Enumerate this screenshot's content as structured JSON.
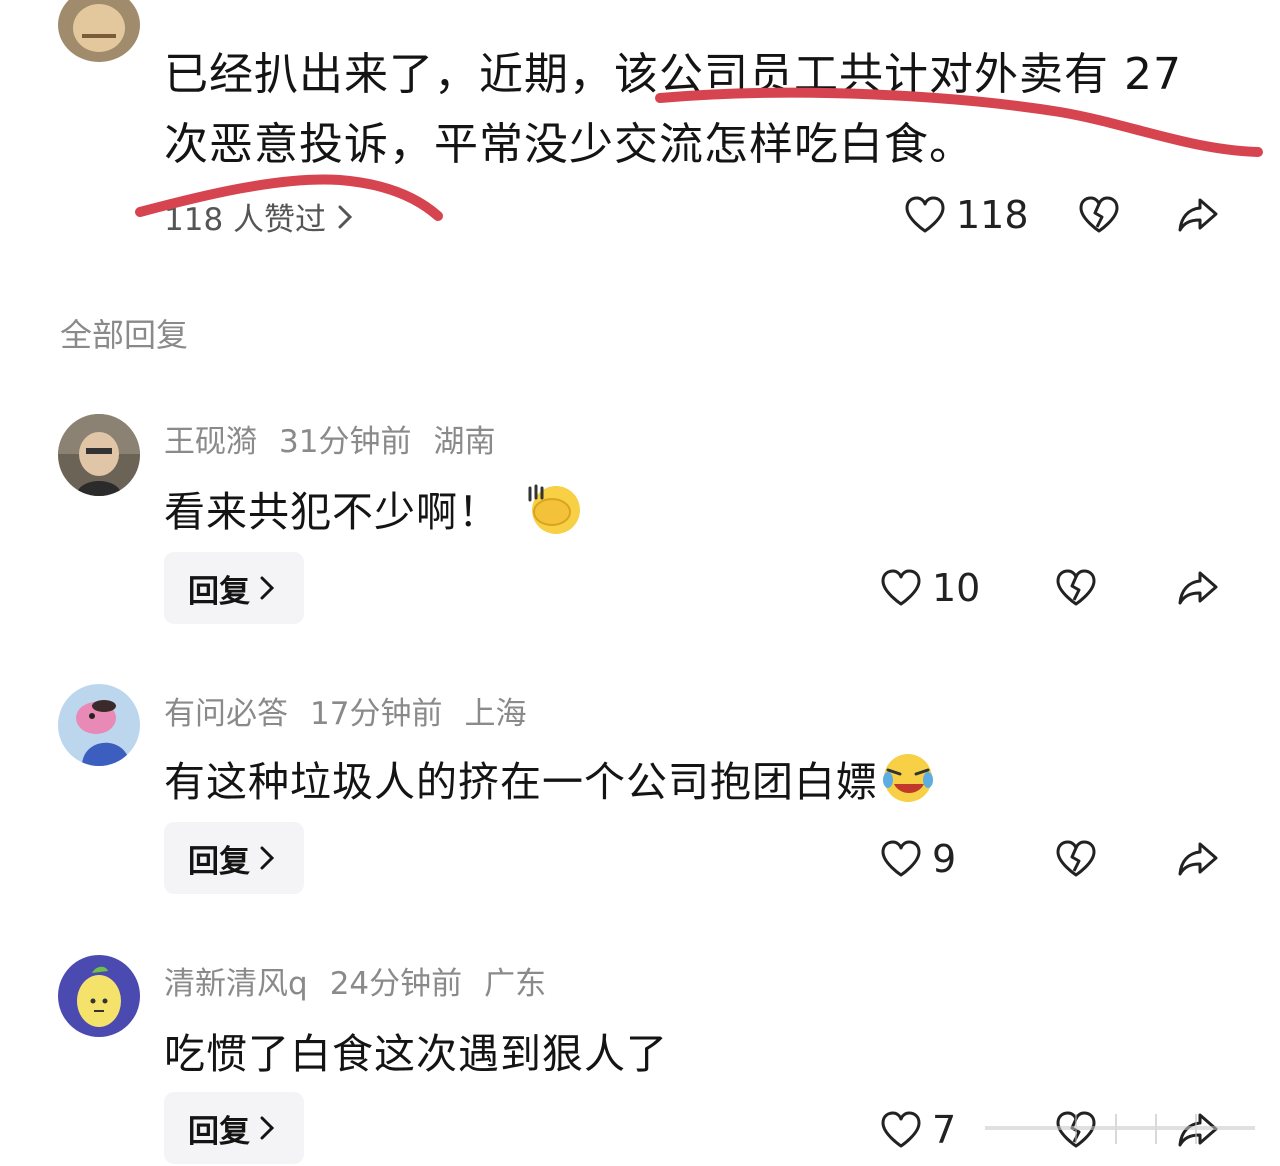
{
  "main_comment": {
    "text_line1": "已经扒出来了，近期，该公司员工共计对外卖有 27",
    "text_line2": "次恶意投诉，平常没少交流怎样吃白食。",
    "likes_summary": "118 人赞过",
    "like_count": "118"
  },
  "section": {
    "title": "全部回复"
  },
  "replies": [
    {
      "username": "王砚漪",
      "time": "31分钟前",
      "location": "湖南",
      "content": "看来共犯不少啊！",
      "emoji": "facepalm",
      "reply_label": "回复",
      "like_count": "10"
    },
    {
      "username": "有问必答",
      "time": "17分钟前",
      "location": "上海",
      "content": "有这种垃圾人的挤在一个公司抱团白嫖",
      "emoji": "rofl",
      "reply_label": "回复",
      "like_count": "9"
    },
    {
      "username": "清新清风q",
      "time": "24分钟前",
      "location": "广东",
      "content": "吃惯了白食这次遇到狠人了",
      "emoji": "",
      "reply_label": "回复",
      "like_count": "7"
    }
  ],
  "icons": {
    "like": "heart-icon",
    "dislike": "broken-heart-icon",
    "share": "share-arrow-icon",
    "chevron": "chevron-right-icon"
  },
  "colors": {
    "annotation": "#d6454f",
    "muted": "#8a8a8a",
    "text": "#141414"
  }
}
